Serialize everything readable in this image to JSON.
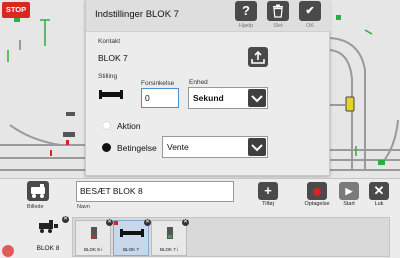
{
  "dialog": {
    "title": "Indstillinger BLOK 7",
    "buttons": [
      {
        "icon": "question-icon",
        "label": "Hjælp",
        "glyph": "?"
      },
      {
        "icon": "trash-icon",
        "label": "Slet",
        "glyph": "🗑"
      },
      {
        "icon": "check-icon",
        "label": "OK",
        "glyph": "✔"
      }
    ],
    "contact_label": "Kontakt",
    "contact_value": "BLOK 7",
    "position_label": "Stilling",
    "delay_label": "Forsinkelse",
    "delay_value": "0",
    "unit_label": "Enhed",
    "unit_value": "Sekund",
    "action_label": "Aktion",
    "condition_label": "Betingelse",
    "condition_value": "Vente"
  },
  "layout": {
    "stop_label": "STOP"
  },
  "bottom": {
    "picture_label": "Billede",
    "name_label": "Navn",
    "name_value": "BESÆT        BLOK 8",
    "buttons": [
      {
        "icon": "plus-icon",
        "label": "Tilføj"
      },
      {
        "icon": "record-icon",
        "label": "Optagelse"
      },
      {
        "icon": "play-icon",
        "label": "Start"
      },
      {
        "icon": "close-icon",
        "label": "Luk"
      }
    ],
    "item_label": "BLOK 8",
    "sequence": [
      {
        "label": "BLOK 8 i",
        "selected": false
      },
      {
        "label": "BLOK 7",
        "selected": true
      },
      {
        "label": "BLOK 7 i",
        "selected": false
      }
    ]
  }
}
